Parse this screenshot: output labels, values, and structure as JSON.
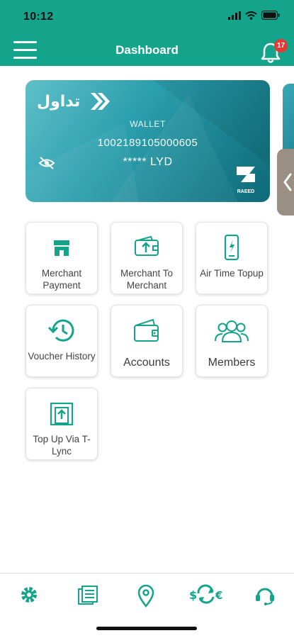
{
  "status_bar": {
    "time": "10:12"
  },
  "header": {
    "title": "Dashboard",
    "notification_count": "17"
  },
  "card": {
    "brand": "تداول",
    "label": "WALLET",
    "number": "1002189105000605",
    "balance": "***** LYD",
    "bank_name": "RAEED"
  },
  "tiles": [
    {
      "label": "Merchant Payment",
      "icon": "store-icon"
    },
    {
      "label": "Merchant To Merchant",
      "icon": "wallet-transfer-icon"
    },
    {
      "label": "Air Time Topup",
      "icon": "phone-topup-icon"
    },
    {
      "label": "Voucher History",
      "icon": "history-icon"
    },
    {
      "label": "Accounts",
      "icon": "wallet-icon"
    },
    {
      "label": "Members",
      "icon": "members-icon"
    },
    {
      "label": "Top Up Via T-Lync",
      "icon": "topup-icon"
    }
  ],
  "bottom_nav": [
    "settings-icon",
    "statements-icon",
    "location-icon",
    "currency-exchange-icon",
    "support-icon"
  ],
  "colors": {
    "primary": "#14a38b",
    "badge": "#e53935"
  }
}
